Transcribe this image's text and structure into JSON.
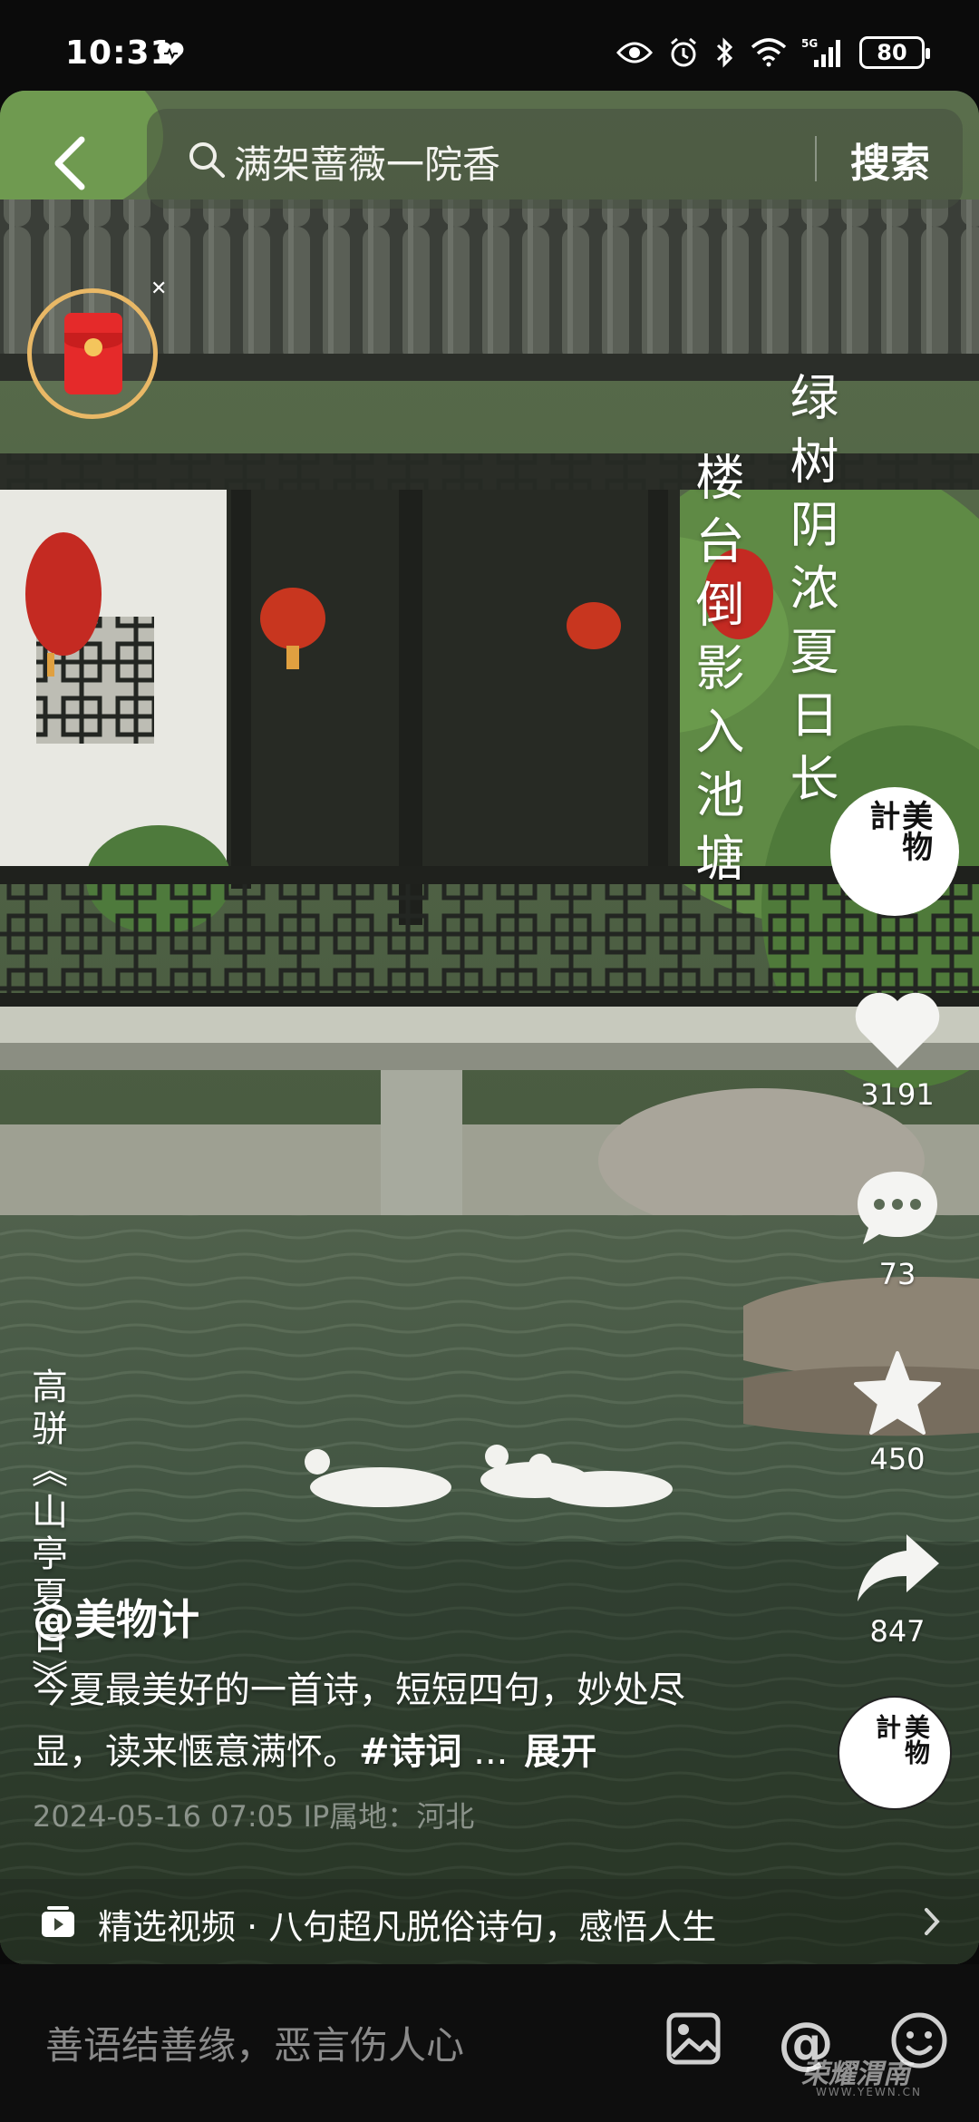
{
  "status_bar": {
    "time": "10:31",
    "network": "5G",
    "battery": "80",
    "icons": [
      "heart-icon",
      "eye-icon",
      "alarm-icon",
      "bluetooth-icon",
      "wifi-icon",
      "signal-icon",
      "battery-icon"
    ]
  },
  "search": {
    "query": "满架蔷薇一院香",
    "button_label": "搜索"
  },
  "poem": {
    "line1": "绿树阴浓夏日长",
    "line2": "楼台倒影入池塘",
    "author": "高骈《山亭夏日》"
  },
  "creator": {
    "avatar_text_1": "美物",
    "avatar_text_2": "計",
    "username": "@美物计"
  },
  "actions": {
    "likes": "3191",
    "comments": "73",
    "favorites": "450",
    "shares": "847"
  },
  "music_disc": {
    "text_1": "美物",
    "text_2": "計"
  },
  "caption": {
    "text": "今夏最美好的一首诗，短短四句，妙处尽显，读来惬意满怀。",
    "hashtag": "#诗词",
    "ellipsis": " ...",
    "expand_label": "展开",
    "timestamp": "2024-05-16 07:05  IP属地：河北"
  },
  "collection": {
    "text": "精选视频 · 八句超凡脱俗诗句，感悟人生"
  },
  "comment_bar": {
    "placeholder": "善语结善缘，恶言伤人心",
    "watermark": "荣耀渭南",
    "watermark_sub": "WWW.YEWN.CN"
  },
  "colors": {
    "accent_gold": "#e9b866",
    "red_packet": "#e52a2a",
    "background": "#0b0b0b"
  }
}
